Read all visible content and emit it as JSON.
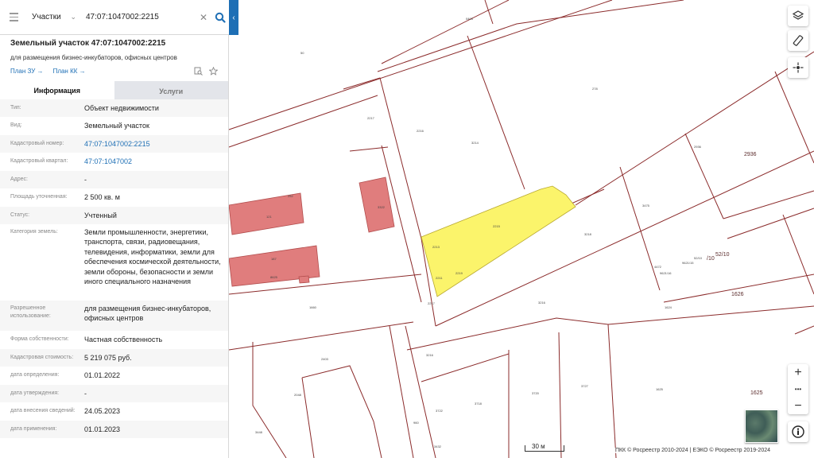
{
  "search": {
    "type_label": "Участки",
    "query": "47:07:1047002:2215"
  },
  "panel": {
    "title": "Земельный участок 47:07:1047002:2215",
    "subtitle": "для размещения бизнес-инкубаторов, офисных центров",
    "plan_zu": "План ЗУ →",
    "plan_kk": "План КК →",
    "tabs": [
      {
        "label": "Информация",
        "active": true
      },
      {
        "label": "Услуги",
        "active": false
      }
    ],
    "rows": [
      {
        "label": "Тип:",
        "value": "Объект недвижимости"
      },
      {
        "label": "Вид:",
        "value": "Земельный участок"
      },
      {
        "label": "Кадастровый номер:",
        "value": "47:07:1047002:2215"
      },
      {
        "label": "Кадастровый квартал:",
        "value": "47:07:1047002"
      },
      {
        "label": "Адрес:",
        "value": "-"
      },
      {
        "label": "Площадь уточненная:",
        "value": "2 500 кв. м"
      },
      {
        "label": "Статус:",
        "value": "Учтенный"
      },
      {
        "label": "Категория земель:",
        "value": "Земли промышленности, энергетики, транспорта, связи, радиовещания, телевидения, информатики, земли для обеспечения космической деятельности, земли обороны, безопасности и земли иного специального назначения"
      },
      {
        "label": "Разрешенное использование:",
        "value": "для размещения бизнес-инкубаторов, офисных центров"
      },
      {
        "label": "Форма собственности:",
        "value": "Частная собственность"
      },
      {
        "label": "Кадастровая стоимость:",
        "value": "5 219 075 руб."
      },
      {
        "label": "дата определения:",
        "value": "01.01.2022"
      },
      {
        "label": "дата утверждения:",
        "value": "-"
      },
      {
        "label": "дата внесения сведений:",
        "value": "24.05.2023"
      },
      {
        "label": "дата применения:",
        "value": "01.01.2023"
      }
    ]
  },
  "map": {
    "labels": {
      "large_2936": "2936",
      "large_1626": "1626",
      "large_1625": "1625",
      "ratio_52_10": "52/10",
      "slash_10": "/10",
      "scale": "30 м"
    },
    "colors": {
      "boundary": "#8b2b2b",
      "selected_fill": "#fbf46b",
      "building_fill": "#e07d7d",
      "accent": "#1e6fb5"
    }
  },
  "footer": {
    "copyright": "ПКК © Росреестр 2010-2024 | ЕЭКО © Росреестр 2019-2024"
  },
  "controls": {
    "zoom_in": "+",
    "more": "•••",
    "zoom_out": "−"
  }
}
